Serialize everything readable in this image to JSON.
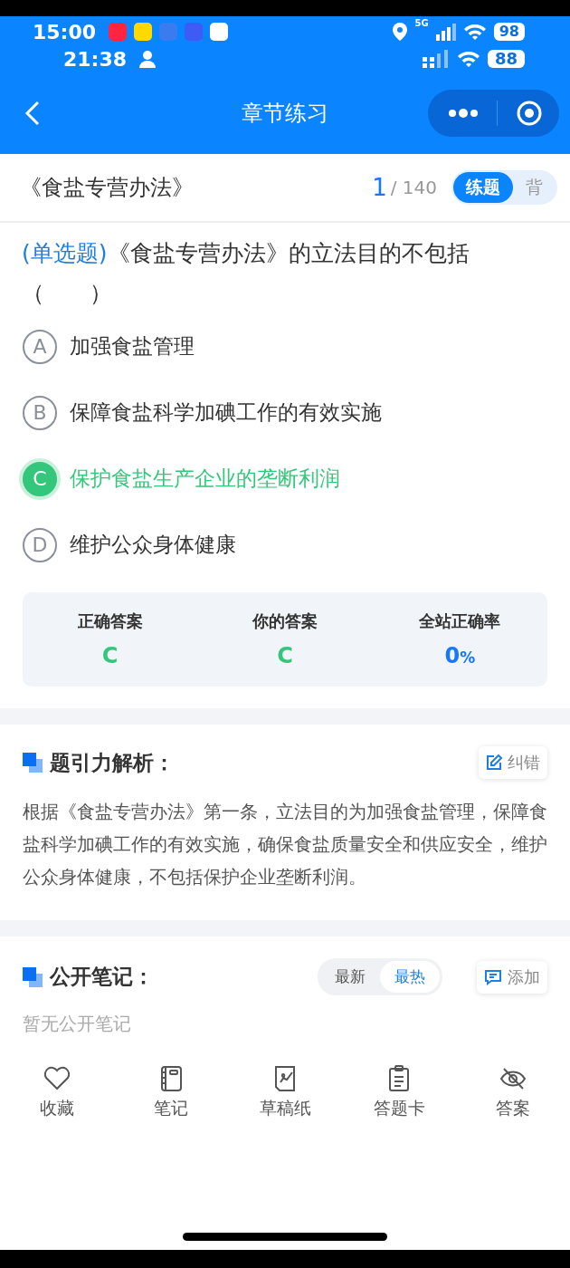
{
  "status_bar": {
    "time": "15:00",
    "time_2": "21:38",
    "network": "5G",
    "battery": "98",
    "battery_2": "88"
  },
  "nav": {
    "title": "章节练习"
  },
  "header": {
    "title": "《食盐专营办法》",
    "current": "1",
    "total": "/ 140",
    "modes": [
      {
        "label": "练题",
        "selected": true
      },
      {
        "label": "背",
        "selected": false
      }
    ]
  },
  "question": {
    "type": "(单选题)",
    "text": "《食盐专营办法》的立法目的不包括（　　）"
  },
  "options": [
    {
      "letter": "A",
      "text": "加强食盐管理",
      "selected": false
    },
    {
      "letter": "B",
      "text": "保障食盐科学加碘工作的有效实施",
      "selected": false
    },
    {
      "letter": "C",
      "text": "保护食盐生产企业的垄断利润",
      "selected": true
    },
    {
      "letter": "D",
      "text": "维护公众身体健康",
      "selected": false
    }
  ],
  "stats": [
    {
      "label": "正确答案",
      "kind": "letter",
      "value": "C"
    },
    {
      "label": "你的答案",
      "kind": "letter",
      "value": "C"
    },
    {
      "label": "全站正确率",
      "kind": "percent",
      "value": "0",
      "unit": "%"
    }
  ],
  "analysis": {
    "title": "题引力解析：",
    "action": "纠错",
    "text": "根据《食盐专营办法》第一条，立法目的为加强食盐管理，保障食盐科学加碘工作的有效实施，确保食盐质量安全和供应安全，维护公众身体健康，不包括保护企业垄断利润。"
  },
  "notes": {
    "title": "公开笔记：",
    "sorts": [
      {
        "label": "最新",
        "selected": false
      },
      {
        "label": "最热",
        "selected": true
      }
    ],
    "action": "添加",
    "empty": "暂无公开笔记"
  },
  "bottom_nav": [
    {
      "kind": "heart",
      "label": "收藏"
    },
    {
      "kind": "notebook",
      "label": "笔记"
    },
    {
      "kind": "draft",
      "label": "草稿纸"
    },
    {
      "kind": "card",
      "label": "答题卡"
    },
    {
      "kind": "eye",
      "label": "答案"
    }
  ]
}
